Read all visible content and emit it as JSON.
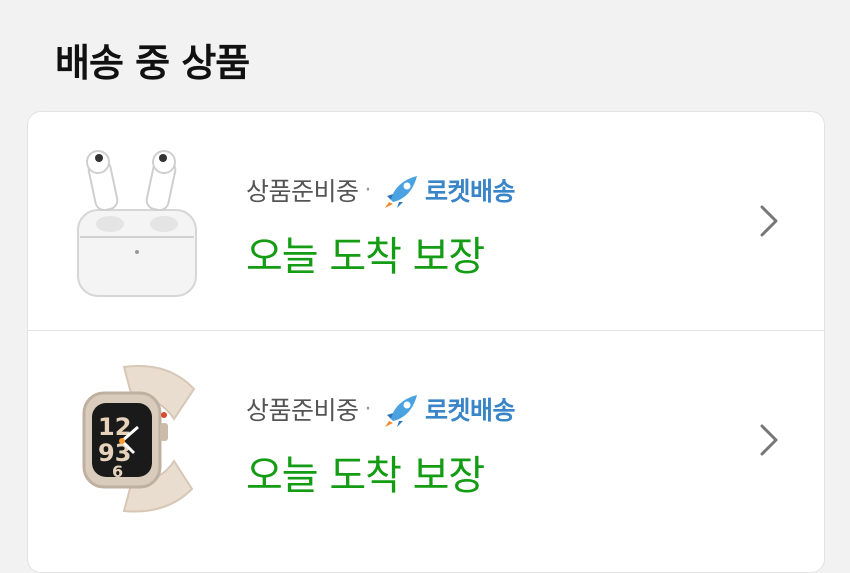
{
  "section": {
    "title": "배송 중 상품"
  },
  "colors": {
    "arrival": "#149c14",
    "rocket": "#3a84c8",
    "status": "#555555"
  },
  "items": [
    {
      "image_icon": "airpods-pro-product-image",
      "status": "상품준비중",
      "separator": "·",
      "delivery_badge": "로켓배송",
      "arrival": "오늘 도착 보장"
    },
    {
      "image_icon": "apple-watch-se-product-image",
      "status": "상품준비중",
      "separator": "·",
      "delivery_badge": "로켓배송",
      "arrival": "오늘 도착 보장"
    }
  ]
}
